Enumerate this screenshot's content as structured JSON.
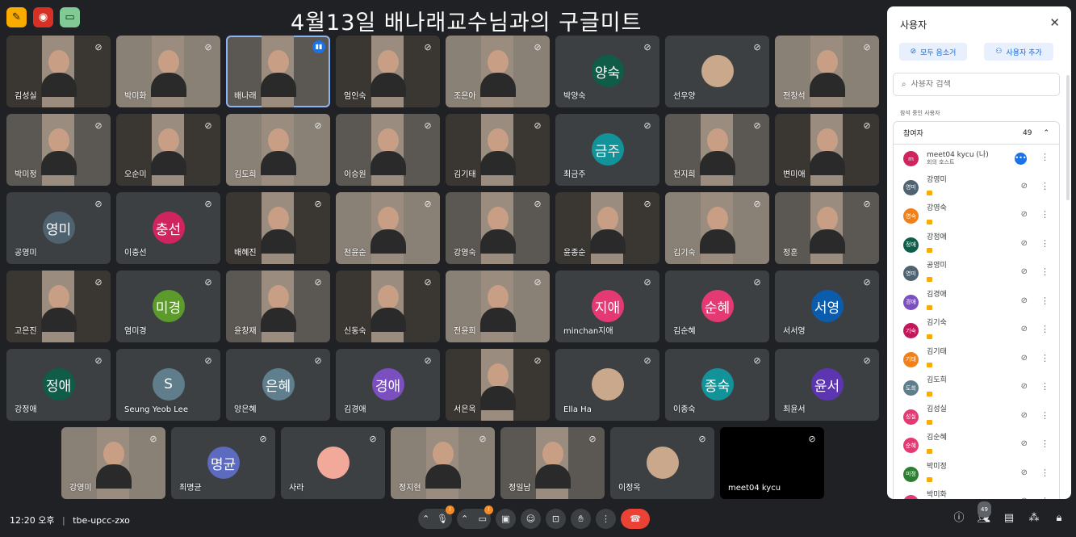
{
  "meeting_title": "4월13일  배나래교수님과의  구글미트",
  "top_icons": [
    {
      "icon": "pen-icon",
      "color": "#f9ab00"
    },
    {
      "icon": "record-icon",
      "color": "#d93025"
    },
    {
      "icon": "cast-icon",
      "color": "#81c995"
    }
  ],
  "tiles": [
    {
      "name": "김성실",
      "kind": "video"
    },
    {
      "name": "박미화",
      "kind": "video"
    },
    {
      "name": "배나래",
      "kind": "video",
      "speaking": true
    },
    {
      "name": "엄인숙",
      "kind": "video"
    },
    {
      "name": "조은아",
      "kind": "video"
    },
    {
      "name": "박양숙",
      "kind": "avatar",
      "initials": "양숙",
      "color": "#0f5c49"
    },
    {
      "name": "선우양",
      "kind": "photo"
    },
    {
      "name": "전창석",
      "kind": "video"
    },
    {
      "name": "박미정",
      "kind": "video"
    },
    {
      "name": "오순미",
      "kind": "video"
    },
    {
      "name": "김도희",
      "kind": "video"
    },
    {
      "name": "이승원",
      "kind": "video"
    },
    {
      "name": "김기태",
      "kind": "video"
    },
    {
      "name": "최금주",
      "kind": "avatar",
      "initials": "금주",
      "color": "#12939a"
    },
    {
      "name": "천지희",
      "kind": "video"
    },
    {
      "name": "변미애",
      "kind": "video"
    },
    {
      "name": "공영미",
      "kind": "avatar",
      "initials": "영미",
      "color": "#4f6270"
    },
    {
      "name": "이충선",
      "kind": "avatar",
      "initials": "충선",
      "color": "#d0245f"
    },
    {
      "name": "배혜진",
      "kind": "video"
    },
    {
      "name": "천윤순",
      "kind": "video"
    },
    {
      "name": "강영숙",
      "kind": "video"
    },
    {
      "name": "윤종순",
      "kind": "video"
    },
    {
      "name": "김기숙",
      "kind": "video"
    },
    {
      "name": "정훈",
      "kind": "video"
    },
    {
      "name": "고은진",
      "kind": "video"
    },
    {
      "name": "염미경",
      "kind": "avatar",
      "initials": "미경",
      "color": "#5b9a2b"
    },
    {
      "name": "윤창재",
      "kind": "video"
    },
    {
      "name": "신동숙",
      "kind": "video"
    },
    {
      "name": "전윤희",
      "kind": "video"
    },
    {
      "name": "minchan지애",
      "kind": "avatar",
      "initials": "지애",
      "color": "#e53973"
    },
    {
      "name": "김순혜",
      "kind": "avatar",
      "initials": "순혜",
      "color": "#e53973"
    },
    {
      "name": "서서영",
      "kind": "avatar",
      "initials": "서영",
      "color": "#0b5cad"
    },
    {
      "name": "강정애",
      "kind": "avatar",
      "initials": "정애",
      "color": "#0f5c49"
    },
    {
      "name": "Seung Yeob Lee",
      "kind": "avatar",
      "initials": "S",
      "color": "#607d8b"
    },
    {
      "name": "양은혜",
      "kind": "avatar",
      "initials": "은혜",
      "color": "#5f7f8f"
    },
    {
      "name": "김경애",
      "kind": "avatar",
      "initials": "경애",
      "color": "#7b4fbf"
    },
    {
      "name": "서은옥",
      "kind": "video"
    },
    {
      "name": "Ella Ha",
      "kind": "photo"
    },
    {
      "name": "이종숙",
      "kind": "avatar",
      "initials": "종숙",
      "color": "#12939a"
    },
    {
      "name": "최윤서",
      "kind": "avatar",
      "initials": "윤서",
      "color": "#5e35b1"
    },
    {
      "name": "강영미",
      "kind": "video"
    },
    {
      "name": "최명균",
      "kind": "avatar",
      "initials": "명균",
      "color": "#5c6bc0"
    },
    {
      "name": "사라",
      "kind": "avatar",
      "initials": "",
      "color": "#f3a99a"
    },
    {
      "name": "정지현",
      "kind": "video"
    },
    {
      "name": "정일남",
      "kind": "video"
    },
    {
      "name": "이정옥",
      "kind": "photo"
    },
    {
      "name": "meet04 kycu",
      "kind": "black"
    }
  ],
  "bottom": {
    "time": "12:20 오후",
    "divider": "|",
    "code": "tbe-upcc-zxo",
    "mic_badge": "!",
    "cam_badge": "!",
    "people_count": "49"
  },
  "panel": {
    "title": "사용자",
    "mute_all": "모두 음소거",
    "add_people": "사용자 추가",
    "search_placeholder": "사용자 검색",
    "section_label": "참석 중인 사용자",
    "group_label": "참여자",
    "group_count": "49",
    "participants": [
      {
        "name": "meet04 kycu (나)",
        "sub": "회의 호스트",
        "initial": "m",
        "color": "#d0245f",
        "host": true
      },
      {
        "name": "강영미",
        "initial": "영미",
        "color": "#4f6270"
      },
      {
        "name": "강영숙",
        "initial": "영숙",
        "color": "#f0801a"
      },
      {
        "name": "강정애",
        "initial": "정애",
        "color": "#0f5c49"
      },
      {
        "name": "공영미",
        "initial": "영미",
        "color": "#4f6270"
      },
      {
        "name": "김경애",
        "initial": "경애",
        "color": "#7b4fbf"
      },
      {
        "name": "김기숙",
        "initial": "기숙",
        "color": "#c2185b"
      },
      {
        "name": "김기태",
        "initial": "기태",
        "color": "#f0801a"
      },
      {
        "name": "김도희",
        "initial": "도희",
        "color": "#607d8b"
      },
      {
        "name": "김성실",
        "initial": "성실",
        "color": "#e53973"
      },
      {
        "name": "김순혜",
        "initial": "순혜",
        "color": "#e53973"
      },
      {
        "name": "박미정",
        "initial": "미정",
        "color": "#2e7d32"
      },
      {
        "name": "박미화",
        "initial": "",
        "color": "#e53973"
      }
    ]
  }
}
